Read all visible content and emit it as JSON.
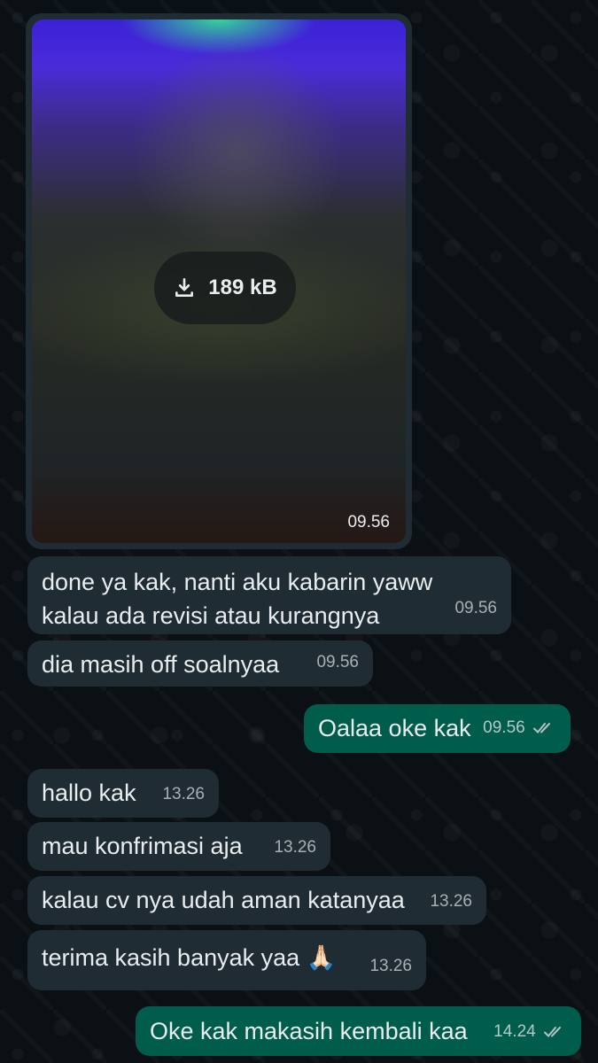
{
  "image_message": {
    "download_icon": "download-icon",
    "size": "189 kB",
    "time": "09.56"
  },
  "messages": [
    {
      "direction": "in",
      "text_line1": "done ya kak, nanti aku kabarin yaww",
      "text_line2": "kalau ada revisi atau kurangnya",
      "time": "09.56"
    },
    {
      "direction": "in",
      "text": "dia masih off soalnyaa",
      "time": "09.56"
    },
    {
      "direction": "out",
      "text": "Oalaa oke kak",
      "time": "09.56",
      "status_icon": "double-check-icon"
    },
    {
      "direction": "in",
      "text": "hallo kak",
      "time": "13.26"
    },
    {
      "direction": "in",
      "text": "mau konfrimasi aja",
      "time": "13.26"
    },
    {
      "direction": "in",
      "text": "kalau cv nya udah aman katanyaa",
      "time": "13.26"
    },
    {
      "direction": "in",
      "text": "terima kasih banyak yaa 🙏🏻",
      "time": "13.26"
    },
    {
      "direction": "out",
      "text": "Oke kak makasih kembali kaa",
      "time": "14.24",
      "status_icon": "double-check-icon"
    }
  ],
  "colors": {
    "background": "#0b1014",
    "incoming_bubble": "#1f2c34",
    "outgoing_bubble": "#005c4b"
  }
}
